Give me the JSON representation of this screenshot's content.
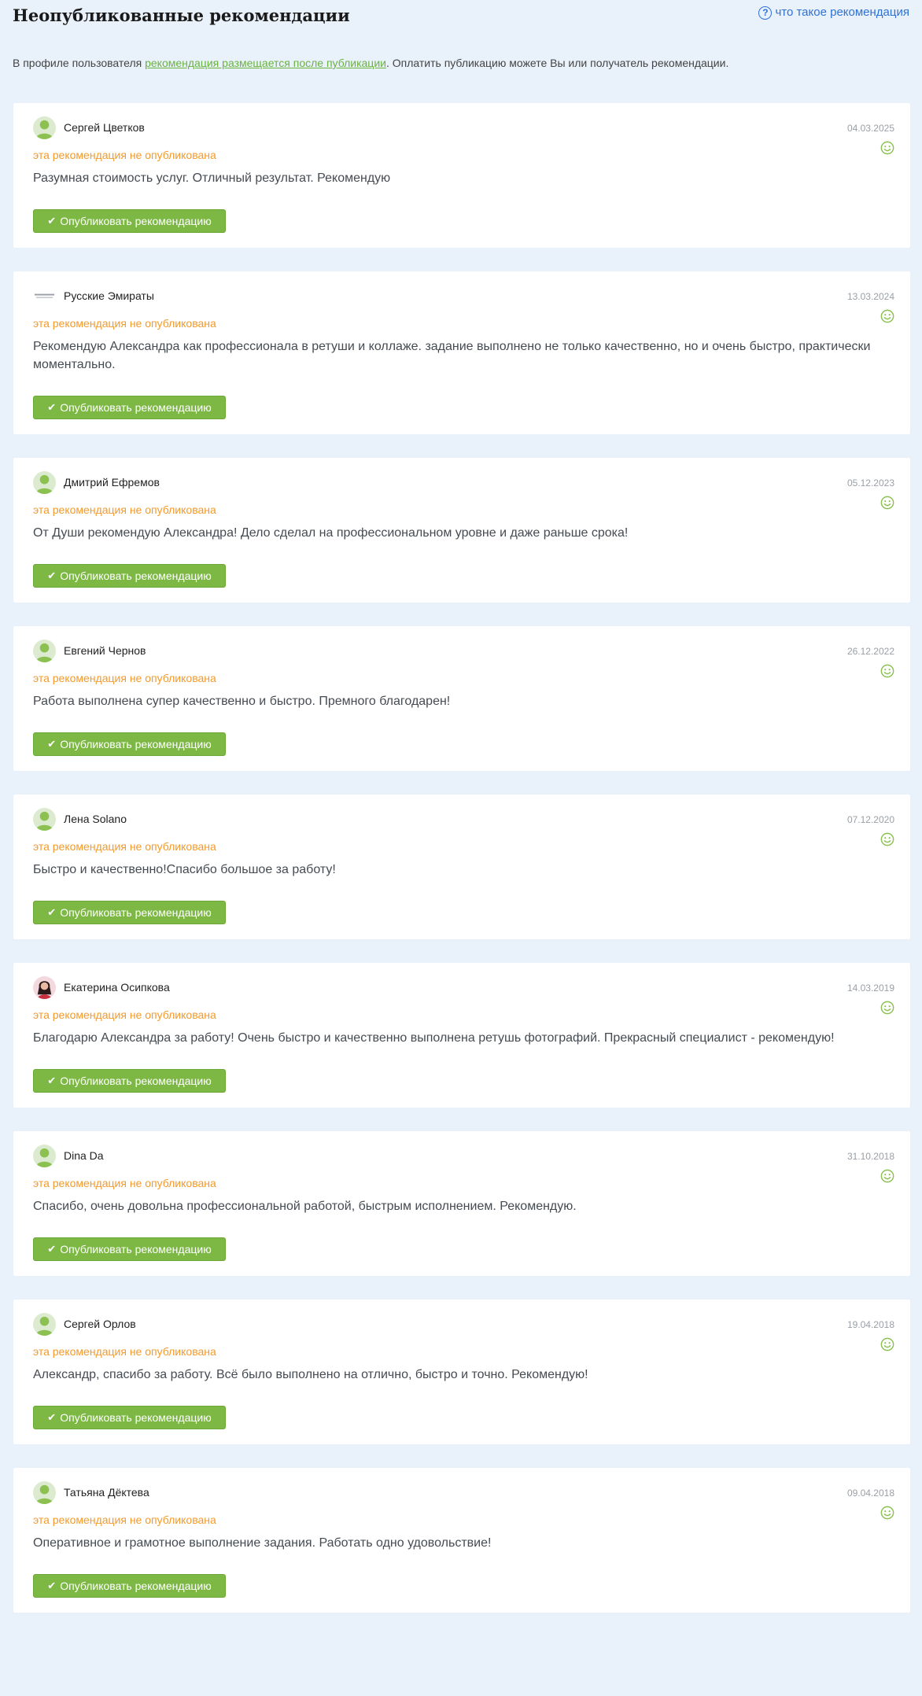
{
  "page": {
    "title": "Неопубликованные рекомендации",
    "help_link": "что такое рекомендация",
    "help_icon": "question-circle-icon",
    "intro_before": "В профиле пользователя ",
    "intro_link": "рекомендация размещается после публикации",
    "intro_after": ". Оплатить публикацию можете Вы или получатель рекомендации."
  },
  "colors": {
    "background": "#e9f1fb",
    "accent_green": "#7cb843",
    "status_orange": "#f39a2b",
    "link_blue": "#2f72d6"
  },
  "recommendations": [
    {
      "author": "Сергей Цветков",
      "avatar": "default-user-avatar",
      "date": "04.03.2025",
      "status": "эта рекомендация не опубликована",
      "text": "Разумная стоимость услуг. Отличный результат. Рекомендую",
      "button": "Опубликовать рекомендацию"
    },
    {
      "author": "Русские Эмираты",
      "avatar": "company-logo-avatar",
      "date": "13.03.2024",
      "status": "эта рекомендация не опубликована",
      "text": "Рекомендую Александра как профессионала в ретуши и коллаже. задание выполнено не только качественно, но и очень быстро, практически моментально.",
      "button": "Опубликовать рекомендацию"
    },
    {
      "author": "Дмитрий Ефремов",
      "avatar": "default-user-avatar",
      "date": "05.12.2023",
      "status": "эта рекомендация не опубликована",
      "text": "От Души рекомендую Александра! Дело сделал на профессиональном уровне и даже раньше срока!",
      "button": "Опубликовать рекомендацию"
    },
    {
      "author": "Евгений Чернов",
      "avatar": "default-user-avatar",
      "date": "26.12.2022",
      "status": "эта рекомендация не опубликована",
      "text": "Работа выполнена супер качественно и быстро. Премного благодарен!",
      "button": "Опубликовать рекомендацию"
    },
    {
      "author": "Лена Solano",
      "avatar": "default-user-avatar",
      "date": "07.12.2020",
      "status": "эта рекомендация не опубликована",
      "text": "Быстро и качественно!Спасибо большое за работу!",
      "button": "Опубликовать рекомендацию"
    },
    {
      "author": "Екатерина Осипкова",
      "avatar": "photo-avatar",
      "date": "14.03.2019",
      "status": "эта рекомендация не опубликована",
      "text": "Благодарю Александра за работу! Очень быстро и качественно выполнена ретушь фотографий. Прекрасный специалист - рекомендую!",
      "button": "Опубликовать рекомендацию"
    },
    {
      "author": "Dina Da",
      "avatar": "default-user-avatar",
      "date": "31.10.2018",
      "status": "эта рекомендация не опубликована",
      "text": "Спасибо, очень довольна профессиональной работой, быстрым исполнением. Рекомендую.",
      "button": "Опубликовать рекомендацию"
    },
    {
      "author": "Сергей Орлов",
      "avatar": "default-user-avatar",
      "date": "19.04.2018",
      "status": "эта рекомендация не опубликована",
      "text": "Александр, спасибо за работу. Всё было выполнено на отлично, быстро и точно. Рекомендую!",
      "button": "Опубликовать рекомендацию"
    },
    {
      "author": "Татьяна Дёктева",
      "avatar": "default-user-avatar",
      "date": "09.04.2018",
      "status": "эта рекомендация не опубликована",
      "text": "Оперативное и грамотное выполнение задания. Работать одно удовольствие!",
      "button": "Опубликовать рекомендацию"
    }
  ]
}
